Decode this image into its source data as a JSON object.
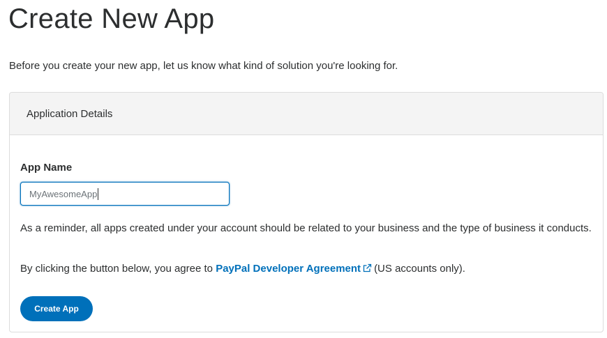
{
  "page": {
    "title": "Create New App",
    "intro": "Before you create your new app, let us know what kind of solution you're looking for."
  },
  "card": {
    "header_title": "Application Details",
    "app_name": {
      "label": "App Name",
      "value": "MyAwesomeApp"
    },
    "reminder_text": "As a reminder, all apps created under your account should be related to your business and the type of business it conducts.",
    "agreement": {
      "prefix": "By clicking the button below, you agree to ",
      "link_text": "PayPal Developer Agreement",
      "link_icon": "external-link-icon",
      "suffix": "(US accounts only)."
    },
    "submit_label": "Create App"
  },
  "colors": {
    "accent": "#0070ba",
    "text": "#2c2e2f",
    "header_bg": "#f4f4f4",
    "border": "#dcdcdc"
  }
}
